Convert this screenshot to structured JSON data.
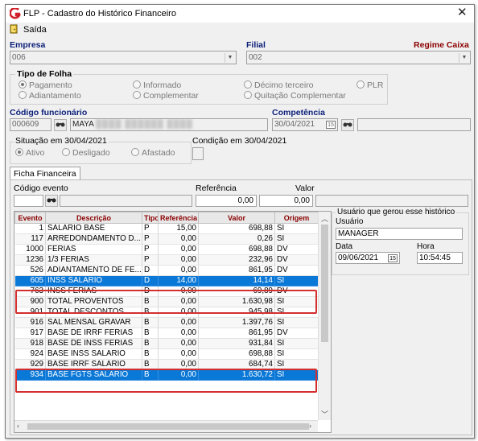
{
  "window": {
    "title": "FLP - Cadastro do Histórico Financeiro"
  },
  "menu": {
    "exit_label": "Saída"
  },
  "empresa": {
    "label": "Empresa",
    "value": "006"
  },
  "filial": {
    "label": "Filial",
    "value": "002",
    "regime_label": "Regime Caixa"
  },
  "tipo_folha": {
    "label": "Tipo de Folha",
    "options": [
      "Pagamento",
      "Informado",
      "Décimo terceiro",
      "PLR",
      "Adiantamento",
      "Complementar",
      "Quitação Complementar"
    ],
    "selected": "Pagamento"
  },
  "funcionario": {
    "label": "Código funcionário",
    "code": "000609",
    "name": "MAYA"
  },
  "competencia": {
    "label": "Competência",
    "value": "30/04/2021"
  },
  "situacao": {
    "label": "Situação em 30/04/2021",
    "options": [
      "Ativo",
      "Desligado",
      "Afastado"
    ],
    "selected": "Ativo"
  },
  "condicao": {
    "label": "Condição em 30/04/2021",
    "value": ""
  },
  "tab": {
    "label": "Ficha Financeira"
  },
  "filters": {
    "codigo_evento_label": "Código evento",
    "referencia_label": "Referência",
    "referencia_value": "0,00",
    "valor_label": "Valor",
    "valor_value": "0,00"
  },
  "grid": {
    "columns": [
      "Evento",
      "Descrição",
      "Tipo",
      "Referência",
      "Valor",
      "Origem"
    ],
    "rows": [
      [
        "1",
        "SALARIO BASE",
        "P",
        "15,00",
        "698,88",
        "SI"
      ],
      [
        "117",
        "ARREDONDAMENTO D...",
        "P",
        "0,00",
        "0,26",
        "SI"
      ],
      [
        "1000",
        "FERIAS",
        "P",
        "0,00",
        "698,88",
        "DV"
      ],
      [
        "1236",
        "1/3 FERIAS",
        "P",
        "0,00",
        "232,96",
        "DV"
      ],
      [
        "526",
        "ADIANTAMENTO DE FE...",
        "D",
        "0,00",
        "861,95",
        "DV"
      ],
      [
        "605",
        "INSS SALARIO",
        "D",
        "14,00",
        "14,14",
        "SI"
      ],
      [
        "763",
        "INSS FERIAS",
        "D",
        "0,00",
        "69,89",
        "DV"
      ],
      [
        "900",
        "TOTAL PROVENTOS",
        "B",
        "0,00",
        "1.630,98",
        "SI"
      ],
      [
        "901",
        "TOTAL DESCONTOS",
        "B",
        "0,00",
        "945,98",
        "SI"
      ],
      [
        "916",
        "SAL MENSAL GRAVAR",
        "B",
        "0,00",
        "1.397,76",
        "SI"
      ],
      [
        "917",
        "BASE DE IRRF FERIAS",
        "B",
        "0,00",
        "861,95",
        "DV"
      ],
      [
        "918",
        "BASE DE INSS FERIAS",
        "B",
        "0,00",
        "931,84",
        "SI"
      ],
      [
        "924",
        "BASE INSS SALARIO",
        "B",
        "0,00",
        "698,88",
        "SI"
      ],
      [
        "929",
        "BASE IRRF SALARIO",
        "B",
        "0,00",
        "684,74",
        "SI"
      ],
      [
        "934",
        "BASE FGTS SALARIO",
        "B",
        "0,00",
        "1.630,72",
        "SI"
      ]
    ],
    "selected_rows": [
      5,
      14
    ]
  },
  "usuario_box": {
    "title": "Usuário que gerou esse histórico",
    "user_label": "Usuário",
    "user_value": "MANAGER",
    "date_label": "Data",
    "date_value": "09/06/2021",
    "time_label": "Hora",
    "time_value": "10:54:45"
  },
  "colors": {
    "accent": "#0a78d7",
    "highlight": "#d32f2f",
    "label_blue": "#0b1f7a",
    "label_red": "#8b0000"
  }
}
